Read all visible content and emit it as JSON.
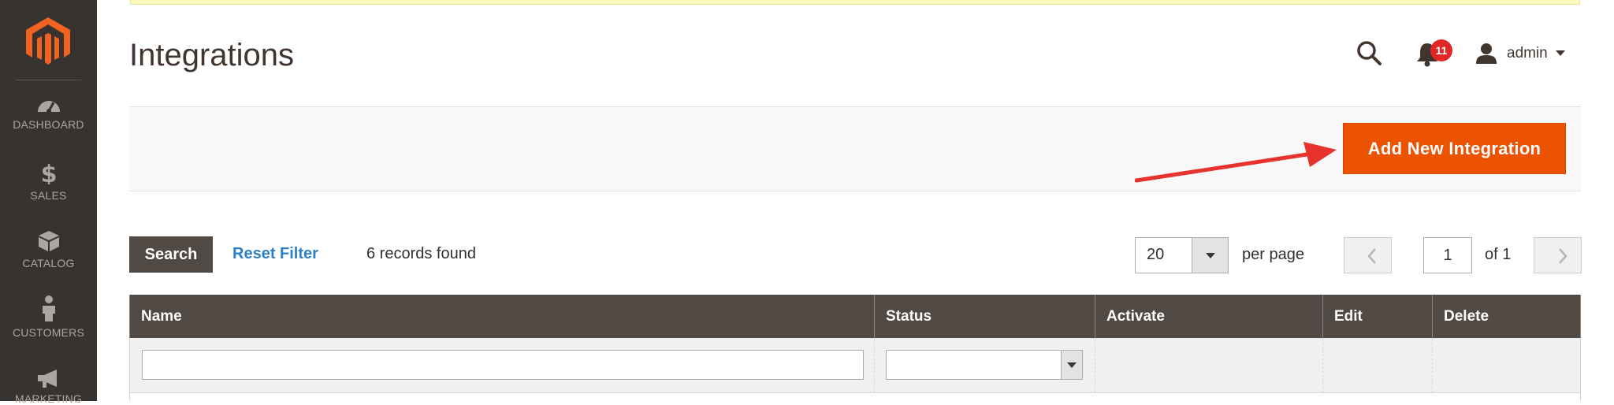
{
  "sidebar": {
    "items": [
      {
        "label": "DASHBOARD",
        "icon": "dashboard-gauge-icon"
      },
      {
        "label": "SALES",
        "icon": "dollar-icon"
      },
      {
        "label": "CATALOG",
        "icon": "box-icon"
      },
      {
        "label": "CUSTOMERS",
        "icon": "person-icon"
      },
      {
        "label": "MARKETING",
        "icon": "megaphone-icon"
      }
    ]
  },
  "header": {
    "title": "Integrations",
    "notifications_count": "11",
    "user_name": "admin"
  },
  "actions": {
    "add_label": "Add New Integration"
  },
  "grid_controls": {
    "search_label": "Search",
    "reset_label": "Reset Filter",
    "records_found": "6 records found",
    "per_page_value": "20",
    "per_page_label": "per page",
    "current_page": "1",
    "of_pages": "of 1"
  },
  "table": {
    "columns": [
      "Name",
      "Status",
      "Activate",
      "Edit",
      "Delete"
    ]
  },
  "colors": {
    "sidebar_bg": "#373330",
    "accent_orange": "#eb5202",
    "table_header_bg": "#514943",
    "link_blue": "#2e7fca",
    "badge_red": "#e22626",
    "annotation_arrow": "#e8322d"
  }
}
